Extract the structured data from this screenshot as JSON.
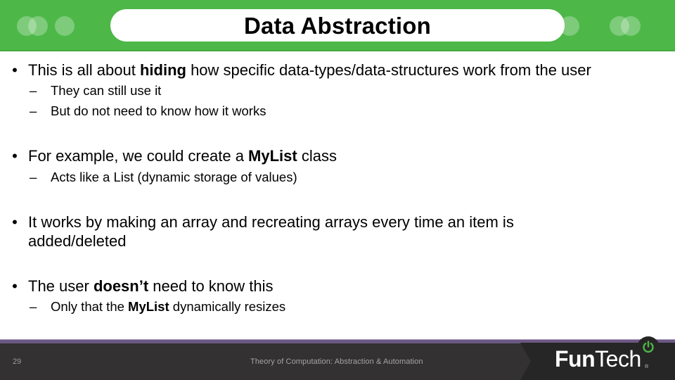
{
  "slide": {
    "title": "Data Abstraction",
    "number": "29"
  },
  "content": {
    "bullets": [
      {
        "parts": [
          "This is all about ",
          "hiding",
          " how specific data-types/data-structures work from the user"
        ],
        "subs": [
          {
            "text": "They can still use it"
          },
          {
            "text": "But do not need to know how it works"
          }
        ]
      },
      {
        "parts": [
          "For example, we could create a ",
          "MyList",
          " class"
        ],
        "subs": [
          {
            "text": "Acts like a List (dynamic storage of values)"
          }
        ]
      },
      {
        "line1": "It works by making an array and recreating arrays every time an item is",
        "line2": "added/deleted"
      },
      {
        "parts": [
          "The user ",
          "doesn’t",
          " need to know this"
        ],
        "subs": [
          {
            "parts": [
              "Only that the ",
              "MyList",
              " dynamically resizes"
            ]
          }
        ]
      }
    ],
    "bullet_glyph": "•",
    "sub_glyph": "–"
  },
  "footer": {
    "text": "Theory of Computation: Abstraction & Automation",
    "logo_fun": "Fun",
    "logo_tech": "Tech",
    "logo_reg": "®"
  },
  "colors": {
    "header_green": "#4db848",
    "footer_dark": "#333132",
    "footer_stripe": "#6b5882",
    "power_green": "#4db848"
  }
}
